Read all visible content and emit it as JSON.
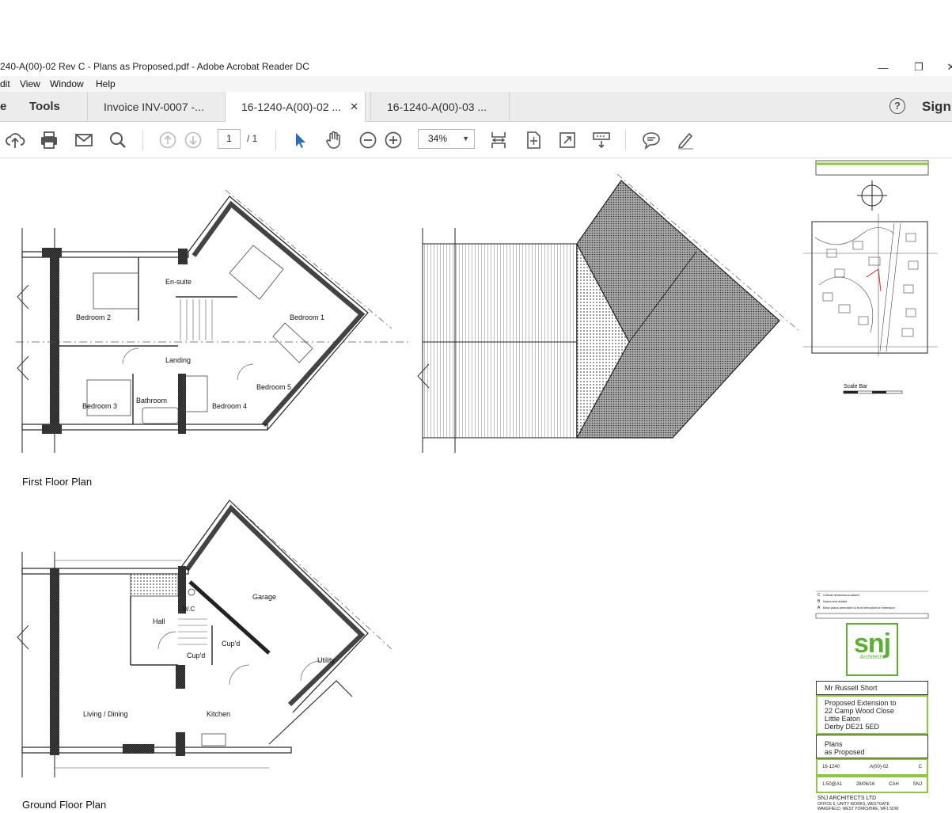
{
  "window": {
    "title": "240-A(00)-02 Rev C - Plans as Proposed.pdf - Adobe Acrobat Reader DC",
    "minimize_glyph": "—",
    "restore_glyph": "❐",
    "close_glyph": "✕"
  },
  "menu": [
    "dit",
    "View",
    "Window",
    "Help"
  ],
  "tabs": {
    "home": "e",
    "tools": "Tools",
    "documents": [
      {
        "label": "Invoice INV-0007 -...",
        "active": false
      },
      {
        "label": "16-1240-A(00)-02 ...",
        "active": true
      },
      {
        "label": "16-1240-A(00)-03 ...",
        "active": false
      }
    ],
    "close_glyph": "✕",
    "help_glyph": "?",
    "sign": "Sign"
  },
  "toolbar": {
    "page_current": "1",
    "page_total": "/ 1",
    "zoom": "34%",
    "icons": [
      "upload-icon",
      "print-icon",
      "mail-icon",
      "search-icon",
      "prev-page-icon",
      "next-page-icon",
      "select-cursor-icon",
      "hand-icon",
      "zoom-out-icon",
      "zoom-in-icon",
      "fit-width-icon",
      "fit-page-icon",
      "full-screen-icon",
      "scroll-mode-icon",
      "comment-icon",
      "highlight-pen-icon"
    ]
  },
  "drawing": {
    "first_floor_caption": "First Floor Plan",
    "ground_floor_caption": "Ground Floor Plan",
    "first_floor_rooms": [
      "En-suite",
      "Bedroom 2",
      "Bedroom 1",
      "Landing",
      "Bedroom 5",
      "Bedroom 3",
      "Bathroom",
      "Bedroom 4"
    ],
    "ground_floor_rooms": [
      "Garage",
      "W.C",
      "Hall",
      "Cup'd",
      "Cup'd",
      "Utility",
      "Living / Dining",
      "Kitchen"
    ],
    "scale_bar": "Scale Bar"
  },
  "title_block": {
    "revisions": [
      {
        "rev": "C",
        "text": "Critical dimensions added"
      },
      {
        "rev": "B",
        "text": "Notes text added"
      },
      {
        "rev": "A",
        "text": "Brick plans amended to front elevation of extension"
      }
    ],
    "logo_word": "snj",
    "logo_sub": "Architects",
    "client": "Mr Russell Short",
    "project": [
      "Proposed Extension to",
      "22 Camp Wood Close",
      "Little Eaton",
      "Derby DE21 5ED"
    ],
    "description": [
      "Plans",
      "as Proposed"
    ],
    "job_no": "16-1240",
    "drawing_no": "A(00)-02",
    "rev": "C",
    "scale": "1:50@A1",
    "date_drawn": "28/06/16",
    "drawn_by": "CAH",
    "authorised_by": "SNJ",
    "company": "SNJ ARCHITECTS LTD",
    "address": [
      "OFFICE 6, UNITY WORKS, WESTGATE",
      "WAKEFIELD, WEST YORKSHIRE, WF1 5DW"
    ]
  }
}
